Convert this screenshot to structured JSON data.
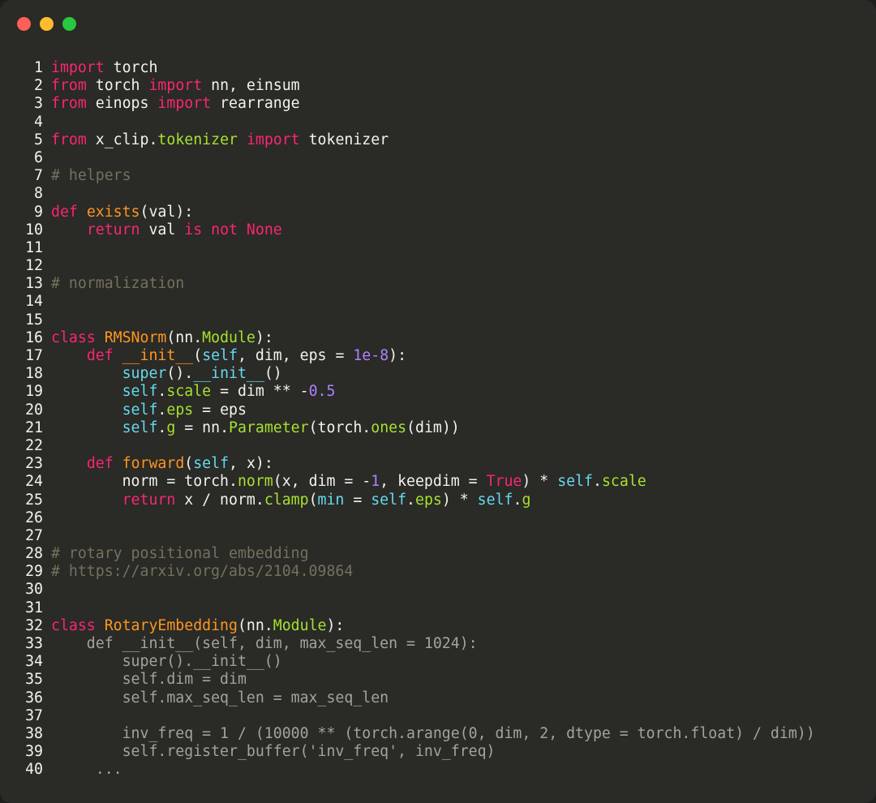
{
  "window": {
    "controls": [
      "close",
      "minimize",
      "zoom"
    ]
  },
  "colors": {
    "background": "#2a2a27",
    "text": "#f2f2ee",
    "keyword": "#f92672",
    "function": "#fd971f",
    "class_ref": "#a6e22e",
    "builtin": "#66d9ef",
    "number": "#ae81ff",
    "comment": "#75715e",
    "dimmed": "#a3a39d"
  },
  "code_lines": [
    {
      "n": "1",
      "tokens": [
        [
          "kw",
          "import"
        ],
        [
          "p",
          " torch"
        ]
      ]
    },
    {
      "n": "2",
      "tokens": [
        [
          "kw",
          "from"
        ],
        [
          "p",
          " torch "
        ],
        [
          "kw",
          "import"
        ],
        [
          "p",
          " nn, einsum"
        ]
      ]
    },
    {
      "n": "3",
      "tokens": [
        [
          "kw",
          "from"
        ],
        [
          "p",
          " einops "
        ],
        [
          "kw",
          "import"
        ],
        [
          "p",
          " rearrange"
        ]
      ]
    },
    {
      "n": "4",
      "tokens": []
    },
    {
      "n": "5",
      "tokens": [
        [
          "kw",
          "from"
        ],
        [
          "p",
          " x_clip."
        ],
        [
          "cls",
          "tokenizer"
        ],
        [
          "p",
          " "
        ],
        [
          "kw",
          "import"
        ],
        [
          "p",
          " tokenizer"
        ]
      ]
    },
    {
      "n": "6",
      "tokens": []
    },
    {
      "n": "7",
      "tokens": [
        [
          "cm",
          "# helpers"
        ]
      ]
    },
    {
      "n": "8",
      "tokens": []
    },
    {
      "n": "9",
      "tokens": [
        [
          "kw",
          "def"
        ],
        [
          "p",
          " "
        ],
        [
          "fn",
          "exists"
        ],
        [
          "p",
          "(val):"
        ]
      ]
    },
    {
      "n": "10",
      "tokens": [
        [
          "p",
          "    "
        ],
        [
          "kw",
          "return"
        ],
        [
          "p",
          " val "
        ],
        [
          "kw",
          "is not None"
        ]
      ]
    },
    {
      "n": "11",
      "tokens": []
    },
    {
      "n": "12",
      "tokens": []
    },
    {
      "n": "13",
      "tokens": [
        [
          "cm",
          "# normalization"
        ]
      ]
    },
    {
      "n": "14",
      "tokens": []
    },
    {
      "n": "15",
      "tokens": []
    },
    {
      "n": "16",
      "tokens": [
        [
          "kw",
          "class"
        ],
        [
          "p",
          " "
        ],
        [
          "fn",
          "RMSNorm"
        ],
        [
          "p",
          "(nn."
        ],
        [
          "cls",
          "Module"
        ],
        [
          "p",
          "):"
        ]
      ]
    },
    {
      "n": "17",
      "tokens": [
        [
          "p",
          "    "
        ],
        [
          "kw",
          "def"
        ],
        [
          "p",
          " "
        ],
        [
          "fn",
          "__init__"
        ],
        [
          "p",
          "("
        ],
        [
          "bi",
          "self"
        ],
        [
          "p",
          ", dim, eps = "
        ],
        [
          "num",
          "1e-8"
        ],
        [
          "p",
          "):"
        ]
      ]
    },
    {
      "n": "18",
      "tokens": [
        [
          "p",
          "        "
        ],
        [
          "bi",
          "super"
        ],
        [
          "p",
          "()."
        ],
        [
          "bi",
          "__init__"
        ],
        [
          "p",
          "()"
        ]
      ]
    },
    {
      "n": "19",
      "tokens": [
        [
          "p",
          "        "
        ],
        [
          "bi",
          "self"
        ],
        [
          "p",
          "."
        ],
        [
          "cls",
          "scale"
        ],
        [
          "p",
          " = dim ** -"
        ],
        [
          "num",
          "0.5"
        ]
      ]
    },
    {
      "n": "20",
      "tokens": [
        [
          "p",
          "        "
        ],
        [
          "bi",
          "self"
        ],
        [
          "p",
          "."
        ],
        [
          "cls",
          "eps"
        ],
        [
          "p",
          " = eps"
        ]
      ]
    },
    {
      "n": "21",
      "tokens": [
        [
          "p",
          "        "
        ],
        [
          "bi",
          "self"
        ],
        [
          "p",
          "."
        ],
        [
          "cls",
          "g"
        ],
        [
          "p",
          " = nn."
        ],
        [
          "cls",
          "Parameter"
        ],
        [
          "p",
          "(torch."
        ],
        [
          "cls",
          "ones"
        ],
        [
          "p",
          "(dim))"
        ]
      ]
    },
    {
      "n": "22",
      "tokens": []
    },
    {
      "n": "23",
      "tokens": [
        [
          "p",
          "    "
        ],
        [
          "kw",
          "def"
        ],
        [
          "p",
          " "
        ],
        [
          "fn",
          "forward"
        ],
        [
          "p",
          "("
        ],
        [
          "bi",
          "self"
        ],
        [
          "p",
          ", x):"
        ]
      ]
    },
    {
      "n": "24",
      "tokens": [
        [
          "p",
          "        norm = torch."
        ],
        [
          "cls",
          "norm"
        ],
        [
          "p",
          "(x, dim = -"
        ],
        [
          "num",
          "1"
        ],
        [
          "p",
          ", keepdim = "
        ],
        [
          "kw",
          "True"
        ],
        [
          "p",
          ") * "
        ],
        [
          "bi",
          "self"
        ],
        [
          "p",
          "."
        ],
        [
          "cls",
          "scale"
        ]
      ]
    },
    {
      "n": "25",
      "tokens": [
        [
          "p",
          "        "
        ],
        [
          "kw",
          "return"
        ],
        [
          "p",
          " x / norm."
        ],
        [
          "cls",
          "clamp"
        ],
        [
          "p",
          "("
        ],
        [
          "bi",
          "min"
        ],
        [
          "p",
          " = "
        ],
        [
          "bi",
          "self"
        ],
        [
          "p",
          "."
        ],
        [
          "cls",
          "eps"
        ],
        [
          "p",
          ") * "
        ],
        [
          "bi",
          "self"
        ],
        [
          "p",
          "."
        ],
        [
          "cls",
          "g"
        ]
      ]
    },
    {
      "n": "26",
      "tokens": []
    },
    {
      "n": "27",
      "tokens": []
    },
    {
      "n": "28",
      "tokens": [
        [
          "cm",
          "# rotary positional embedding"
        ]
      ]
    },
    {
      "n": "29",
      "tokens": [
        [
          "cm",
          "# https://arxiv.org/abs/2104.09864"
        ]
      ]
    },
    {
      "n": "30",
      "tokens": []
    },
    {
      "n": "31",
      "tokens": []
    },
    {
      "n": "32",
      "tokens": [
        [
          "kw",
          "class"
        ],
        [
          "p",
          " "
        ],
        [
          "fn",
          "RotaryEmbedding"
        ],
        [
          "p",
          "(nn."
        ],
        [
          "cls",
          "Module"
        ],
        [
          "p",
          "):"
        ]
      ]
    },
    {
      "n": "33",
      "dim": true,
      "text": "    def __init__(self, dim, max_seq_len = 1024):"
    },
    {
      "n": "34",
      "dim": true,
      "text": "        super().__init__()"
    },
    {
      "n": "35",
      "dim": true,
      "text": "        self.dim = dim"
    },
    {
      "n": "36",
      "dim": true,
      "text": "        self.max_seq_len = max_seq_len"
    },
    {
      "n": "37",
      "tokens": []
    },
    {
      "n": "38",
      "dim": true,
      "text": "        inv_freq = 1 / (10000 ** (torch.arange(0, dim, 2, dtype = torch.float) / dim))"
    },
    {
      "n": "39",
      "dim": true,
      "text": "        self.register_buffer('inv_freq', inv_freq)"
    },
    {
      "n": "40",
      "dim": true,
      "text": "     ..."
    }
  ]
}
